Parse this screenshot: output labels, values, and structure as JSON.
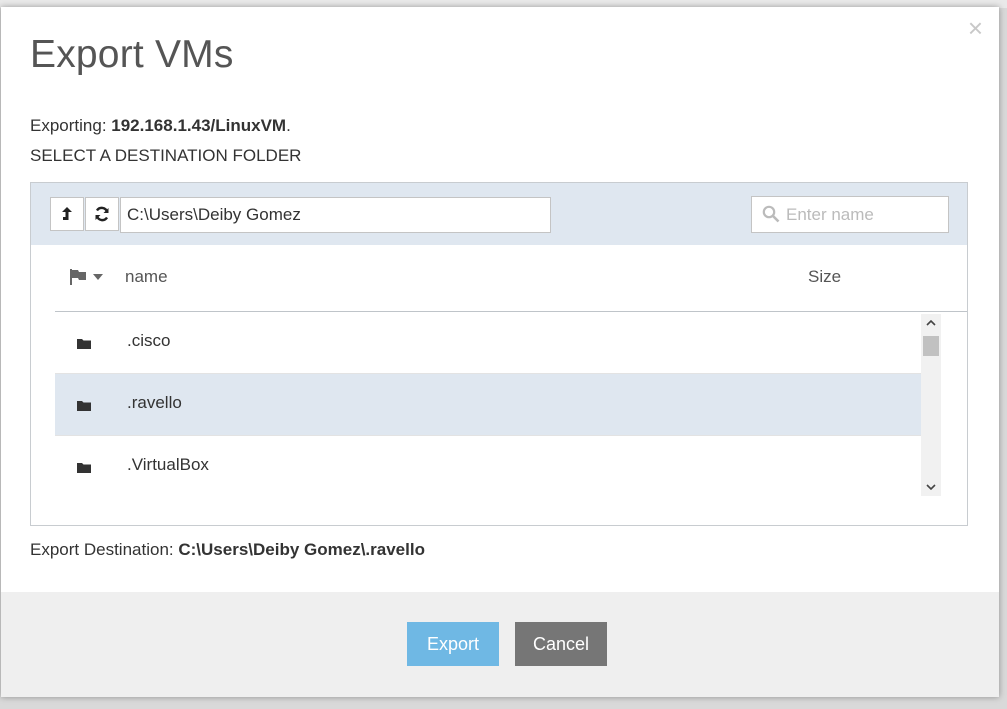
{
  "dialog": {
    "title": "Export VMs",
    "close_glyph": "×",
    "exporting_label": "Exporting: ",
    "exporting_value": "192.168.1.43/LinuxVM",
    "exporting_suffix": ".",
    "select_label": "SELECT A DESTINATION FOLDER"
  },
  "browser": {
    "up_button_icon": "arrow-up-icon",
    "refresh_button_icon": "refresh-icon",
    "path_value": "C:\\Users\\Deiby Gomez",
    "search_placeholder": "Enter name",
    "columns": {
      "name": "name",
      "size": "Size"
    },
    "rows": [
      {
        "name": ".cisco",
        "size": "",
        "selected": false
      },
      {
        "name": ".ravello",
        "size": "",
        "selected": true
      },
      {
        "name": ".VirtualBox",
        "size": "",
        "selected": false
      }
    ]
  },
  "destination": {
    "label": "Export Destination: ",
    "value": "C:\\Users\\Deiby Gomez\\.ravello"
  },
  "footer": {
    "export_label": "Export",
    "cancel_label": "Cancel"
  },
  "colors": {
    "accent": "#6fb8e4",
    "cancel": "#767676",
    "toolbar_bg": "#dfe7f0",
    "selected_row": "#dfe7f0"
  }
}
